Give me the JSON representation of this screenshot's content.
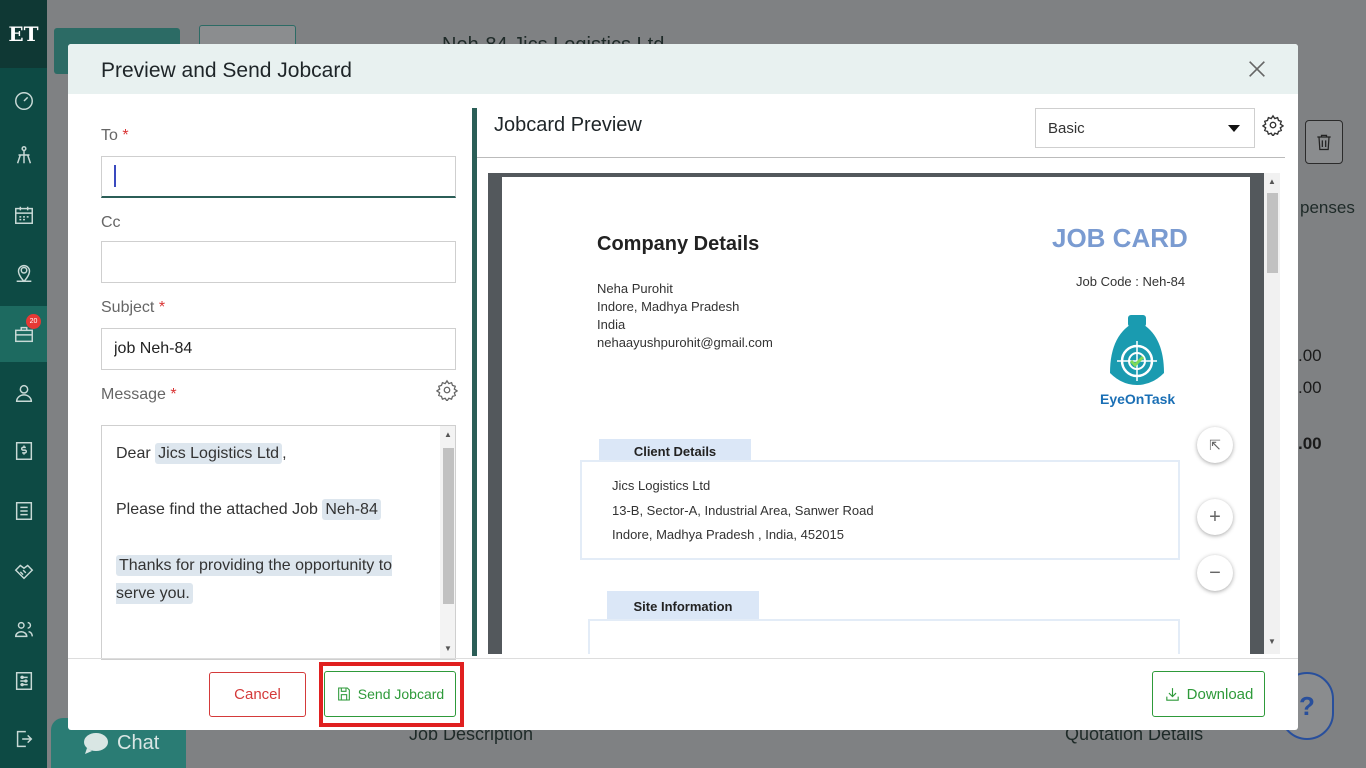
{
  "sidebar": {
    "logo": "ET",
    "badge_count": "20",
    "items": [
      {
        "icon": "dashboard-icon"
      },
      {
        "icon": "lead-icon"
      },
      {
        "icon": "calendar-icon"
      },
      {
        "icon": "map-pin-icon"
      },
      {
        "icon": "jobs-briefcase-icon"
      },
      {
        "icon": "user-icon"
      },
      {
        "icon": "dollar-icon"
      },
      {
        "icon": "list-icon"
      },
      {
        "icon": "handshake-icon"
      },
      {
        "icon": "team-icon"
      },
      {
        "icon": "settings-sliders-icon"
      },
      {
        "icon": "logout-icon"
      }
    ]
  },
  "background": {
    "page_title": "Neh-84 Jics Logistics Ltd",
    "expenses_tab": "penses",
    "amounts": [
      ".00",
      ".00",
      ".00"
    ],
    "job_description": "Job Description",
    "quotation_details": "Quotation Details",
    "chat_label": "Chat",
    "help_label": "?"
  },
  "modal": {
    "title": "Preview and Send Jobcard",
    "form": {
      "to_label": "To",
      "to_value": "",
      "cc_label": "Cc",
      "cc_value": "",
      "subject_label": "Subject",
      "subject_value": "job Neh-84",
      "message_label": "Message",
      "required_mark": "*",
      "message": {
        "greeting": "Dear",
        "client_name": "Jics Logistics Ltd",
        "greeting_suffix": ",",
        "line2_prefix": "Please find the attached Job",
        "job_code": "Neh-84",
        "thanks": "Thanks for providing the opportunity to serve you."
      }
    },
    "preview": {
      "title": "Jobcard Preview",
      "template_selected": "Basic",
      "document": {
        "company_heading": "Company Details",
        "job_card_heading": "JOB CARD",
        "job_code_line": "Job Code : Neh-84",
        "company_name": "Neha Purohit",
        "company_city": "Indore, Madhya Pradesh",
        "company_country": "India",
        "company_email": "nehaayushpurohit@gmail.com",
        "logo_text": "EyeOnTask",
        "client_section": "Client Details",
        "client_name": "Jics Logistics Ltd",
        "client_address1": "13-B, Sector-A, Industrial Area, Sanwer Road",
        "client_address2": "Indore, Madhya Pradesh , India, 452015",
        "site_section": "Site Information"
      },
      "zoom_fit": "⇱",
      "zoom_in": "+",
      "zoom_out": "−"
    },
    "footer": {
      "cancel_label": "Cancel",
      "send_label": "Send Jobcard",
      "download_label": "Download"
    }
  }
}
